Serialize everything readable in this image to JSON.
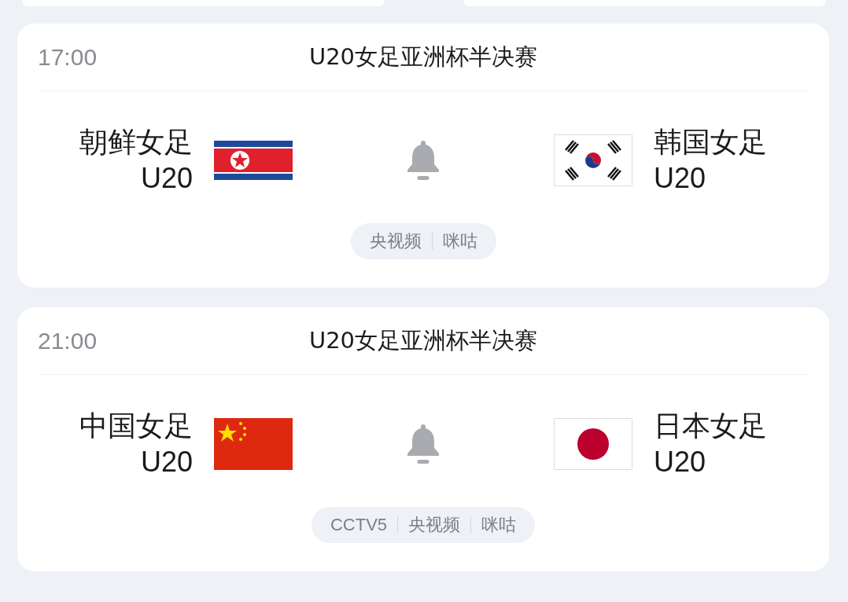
{
  "matches": [
    {
      "time": "17:00",
      "title": "U20女足亚洲杯半决赛",
      "home": {
        "name": "朝鲜女足",
        "group": "U20",
        "kind": "kp"
      },
      "away": {
        "name": "韩国女足",
        "group": "U20",
        "kind": "kr"
      },
      "reminder": false,
      "channels": [
        "央视频",
        "咪咕"
      ]
    },
    {
      "time": "21:00",
      "title": "U20女足亚洲杯半决赛",
      "home": {
        "name": "中国女足",
        "group": "U20",
        "kind": "cn"
      },
      "away": {
        "name": "日本女足",
        "group": "U20",
        "kind": "jp"
      },
      "reminder": false,
      "channels": [
        "CCTV5",
        "央视频",
        "咪咕"
      ]
    }
  ]
}
